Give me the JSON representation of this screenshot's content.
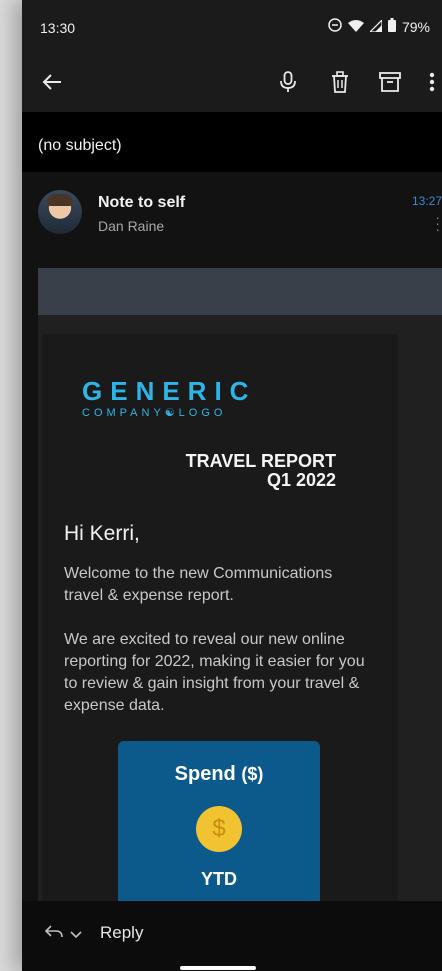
{
  "status_bar": {
    "time": "13:30",
    "battery": "79%"
  },
  "toolbar": {
    "icons": [
      "back-arrow-icon",
      "mic-icon",
      "trash-icon",
      "archive-icon",
      "more-vert-icon"
    ]
  },
  "email": {
    "subject": "(no subject)",
    "sender_title": "Note to self",
    "sender_name": "Dan Raine",
    "time": "13:27"
  },
  "content": {
    "logo_line1": "GENERIC",
    "logo_line2": "COMPANY☯LOGO",
    "report_title": "TRAVEL REPORT",
    "report_period": "Q1 2022",
    "greeting": "Hi Kerri,",
    "para1": "Welcome to the new Communications travel & expense report.",
    "para2": "We are excited to reveal our new online reporting for 2022, making it easier for you to review & gain insight from your travel & expense data.",
    "spend_label": "Spend",
    "spend_unit": "($)",
    "coin_symbol": "$",
    "spend_period": "YTD"
  },
  "reply_bar": {
    "label": "Reply"
  },
  "colors": {
    "accent_blue": "#2cb6e8",
    "card_blue": "#0c5a8c",
    "coin": "#f1c331"
  }
}
